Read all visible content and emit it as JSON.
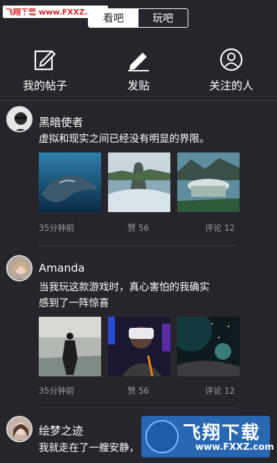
{
  "watermark": "飞翔下载 www.FXXZ.com",
  "tabs": {
    "left": "看吧",
    "right": "玩吧"
  },
  "actions": [
    {
      "label": "我的帖子",
      "icon": "edit-square-icon"
    },
    {
      "label": "发贴",
      "icon": "pencil-icon"
    },
    {
      "label": "关注的人",
      "icon": "user-circle-icon"
    }
  ],
  "posts": [
    {
      "author": "黑暗使者",
      "text": "虚拟和现实之间已经没有明显的界限。",
      "time": "35分钟前",
      "likes_label": "赞",
      "likes": "56",
      "comments_label": "评论",
      "comments": "12"
    },
    {
      "author": "Amanda",
      "text_line1": "当我玩这款游戏时，真心害怕的我确实",
      "text_line2": "感到了一阵惊喜",
      "time": "35分钟前",
      "likes_label": "赞",
      "likes": "56",
      "comments_label": "评论",
      "comments": "12"
    },
    {
      "author": "绘梦之迹",
      "text_line1": "我就走在了一艘安静，"
    }
  ],
  "logo": {
    "title": "飞翔下载",
    "url": "www.FXXZ.com"
  },
  "colors": {
    "background": "#25252b",
    "accent": "#ffffff",
    "logo": "#2b6fc0"
  }
}
